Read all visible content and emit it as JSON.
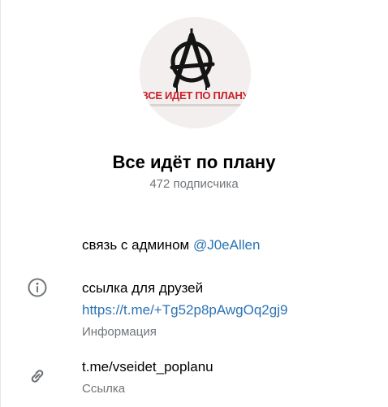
{
  "channel": {
    "name": "Все идёт по плану",
    "subscribers": "472 подписчика",
    "avatar_sign_text": "ВСЕ ИДЕТ ПО ПЛАНУ"
  },
  "about": {
    "admin_prefix": "связь с админом",
    "admin_handle": "@J0eAllen",
    "friends_label": "ссылка для друзей",
    "friends_url": "https://t.me/+Tg52p8pAwgOq2gj9",
    "caption": "Информация"
  },
  "link_row": {
    "value": "t.me/vseidet_poplanu",
    "caption": "Ссылка"
  },
  "icons": {
    "info": "info-icon",
    "link": "link-icon"
  },
  "colors": {
    "link": "#2a73b5",
    "secondary_text": "#707579",
    "avatar_sign_red": "#c8202a"
  }
}
